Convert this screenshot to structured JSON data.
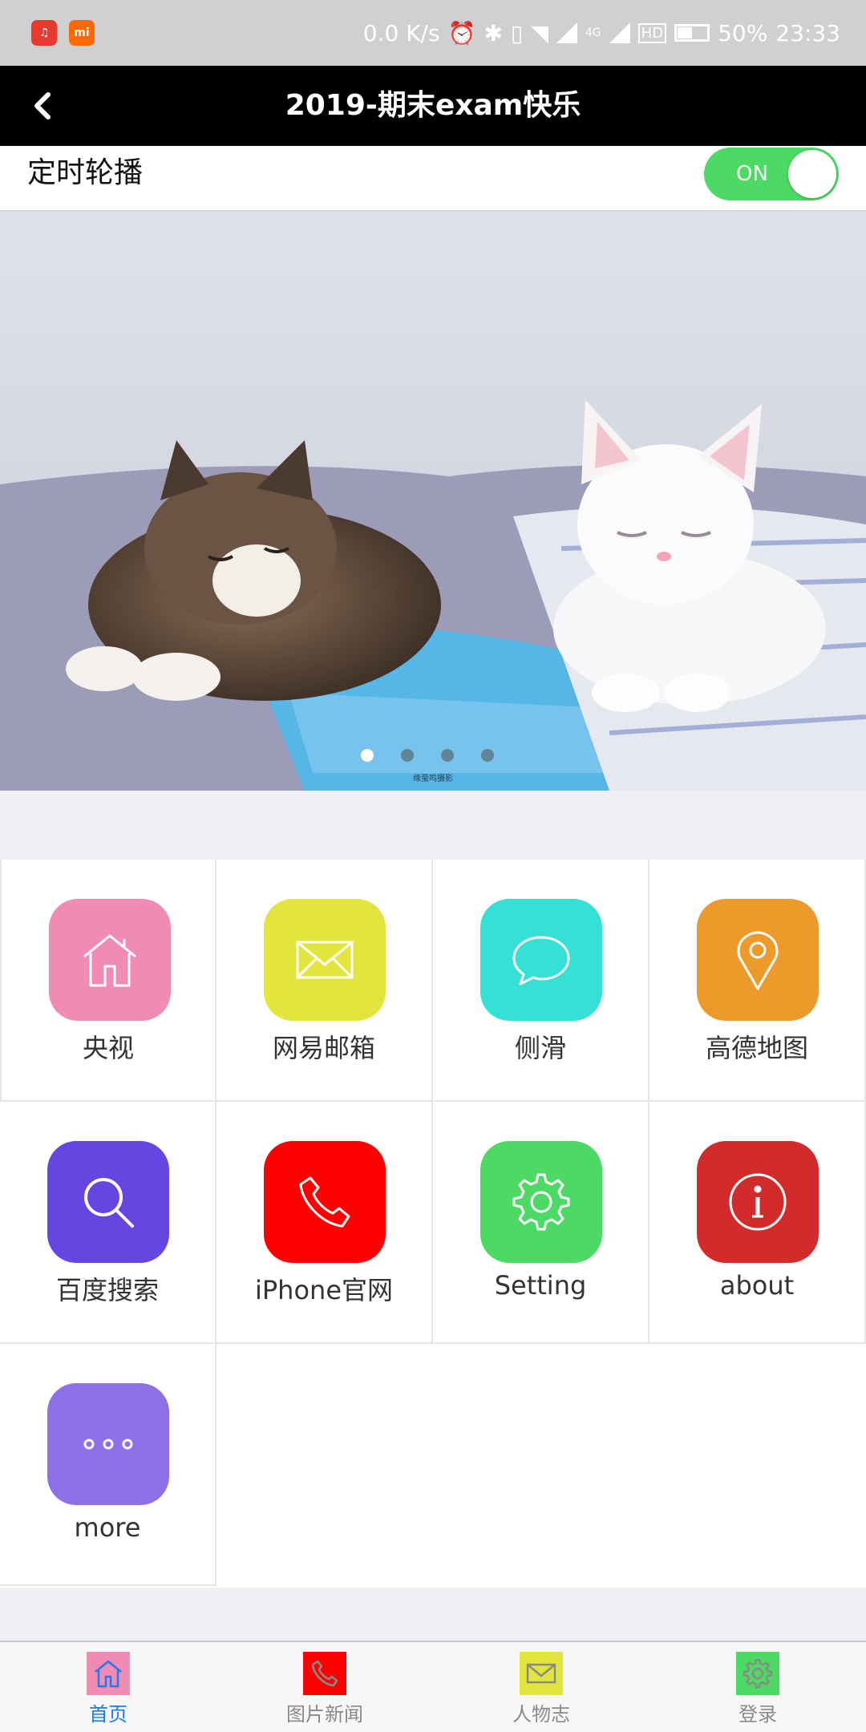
{
  "status_bar": {
    "speed": "0.0 K/s",
    "network": "4G",
    "hd": "HD",
    "battery": "50%",
    "time": "23:33"
  },
  "nav": {
    "title": "2019-期末exam快乐",
    "back_icon": "chevron-left-icon"
  },
  "carousel_setting": {
    "label": "定时轮播",
    "toggle_text": "ON",
    "toggle_on": true,
    "toggle_color": "#4cd964"
  },
  "banner": {
    "current_page": 1,
    "page_count": 4,
    "watermark_line": "缘萤鸣摄影"
  },
  "grid": {
    "items": [
      {
        "label": "央视",
        "icon": "home-icon",
        "color": "#f08bb3"
      },
      {
        "label": "网易邮箱",
        "icon": "mail-icon",
        "color": "#e2e53b"
      },
      {
        "label": "侧滑",
        "icon": "chat-bubble-icon",
        "color": "#35e0d5"
      },
      {
        "label": "高德地图",
        "icon": "map-pin-icon",
        "color": "#ec9a2a"
      },
      {
        "label": "百度搜索",
        "icon": "search-icon",
        "color": "#6446e0"
      },
      {
        "label": "iPhone官网",
        "icon": "phone-icon",
        "color": "#ff0000"
      },
      {
        "label": "Setting",
        "icon": "gear-icon",
        "color": "#4cd964"
      },
      {
        "label": "about",
        "icon": "info-icon",
        "color": "#d22b2b"
      },
      {
        "label": "more",
        "icon": "more-dots-icon",
        "color": "#8e6fe8"
      }
    ]
  },
  "tabbar": {
    "active_index": 0,
    "active_color": "#1a7cf0",
    "items": [
      {
        "label": "首页",
        "icon": "home-icon",
        "color": "#f08bb3"
      },
      {
        "label": "图片新闻",
        "icon": "phone-icon",
        "color": "#ff0000"
      },
      {
        "label": "人物志",
        "icon": "mail-icon",
        "color": "#e2e53b"
      },
      {
        "label": "登录",
        "icon": "gear-icon",
        "color": "#4cd964"
      }
    ]
  }
}
